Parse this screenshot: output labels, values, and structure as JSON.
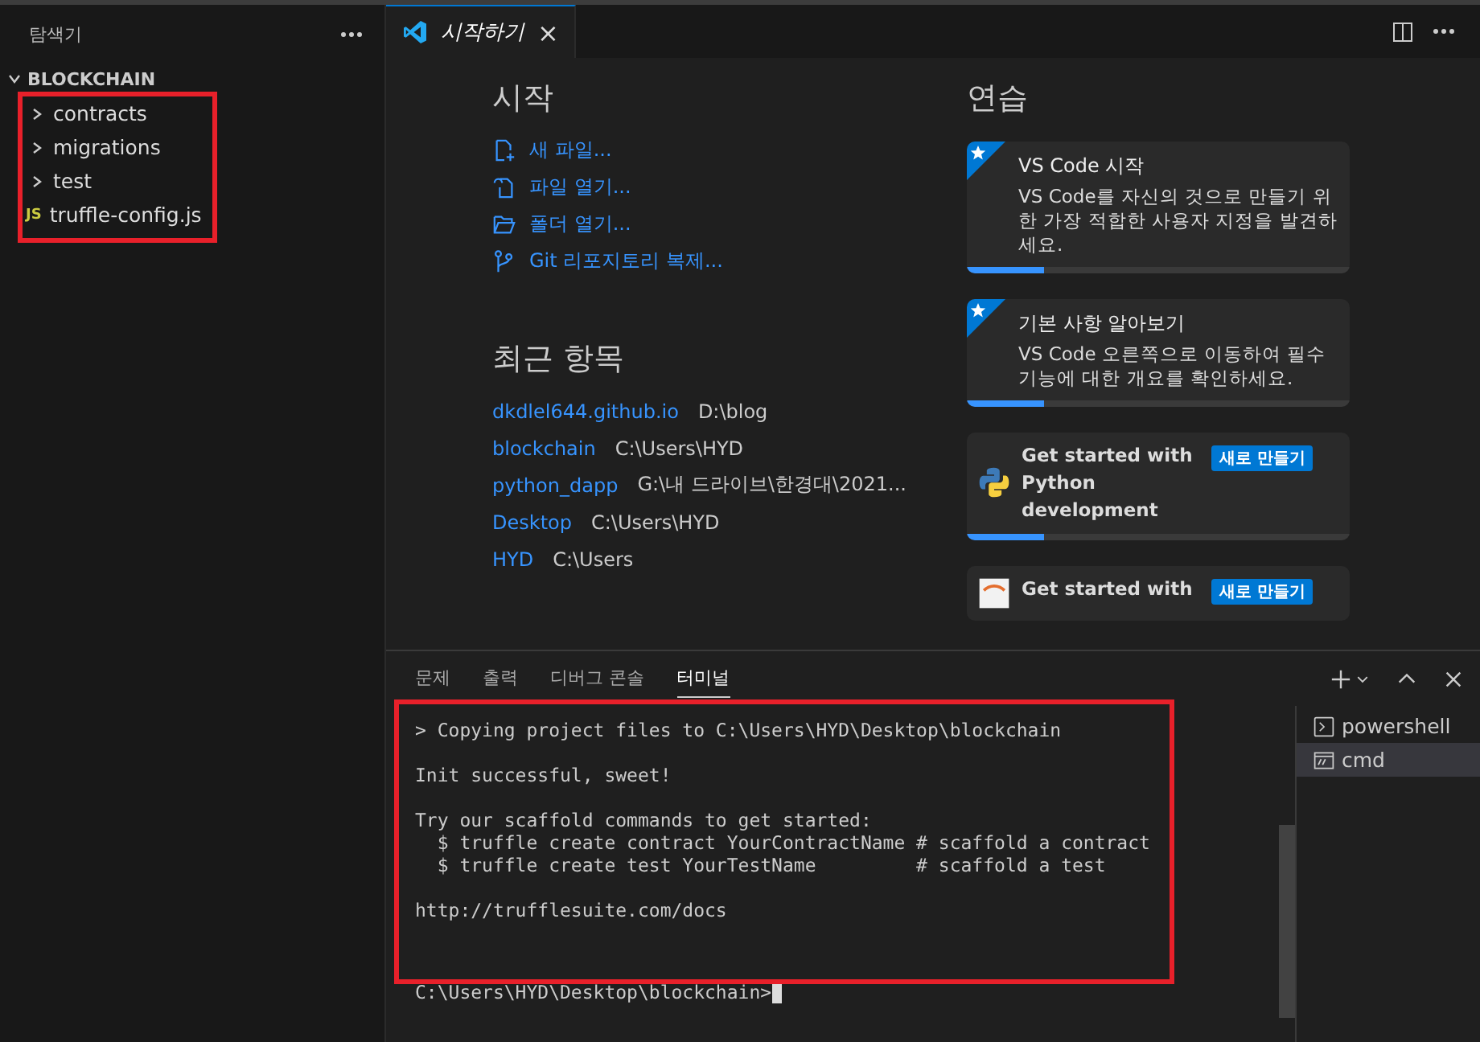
{
  "sidebar": {
    "title": "탐색기",
    "folder": {
      "name": "BLOCKCHAIN",
      "expanded": true
    },
    "items": [
      {
        "kind": "folder",
        "name": "contracts",
        "expanded": false
      },
      {
        "kind": "folder",
        "name": "migrations",
        "expanded": false
      },
      {
        "kind": "folder",
        "name": "test",
        "expanded": false
      },
      {
        "kind": "js",
        "name": "truffle-config.js",
        "badge": "JS"
      }
    ]
  },
  "editor_tabs": [
    {
      "label": "시작하기",
      "selected": true,
      "close": "×"
    }
  ],
  "welcome": {
    "start": {
      "heading": "시작",
      "actions": [
        {
          "kind": "new-file",
          "label": "새 파일..."
        },
        {
          "kind": "open-file",
          "label": "파일 열기..."
        },
        {
          "kind": "folder",
          "label": "폴더 열기..."
        },
        {
          "kind": "git",
          "label": "Git 리포지토리 복제..."
        }
      ]
    },
    "recent": {
      "heading": "최근 항목",
      "items": [
        {
          "name": "dkdlel644.github.io",
          "path": "D:\\blog"
        },
        {
          "name": "blockchain",
          "path": "C:\\Users\\HYD"
        },
        {
          "name": "python_dapp",
          "path": "G:\\내 드라이브\\한경대\\2021..."
        },
        {
          "name": "Desktop",
          "path": "C:\\Users\\HYD"
        },
        {
          "name": "HYD",
          "path": "C:\\Users"
        }
      ]
    },
    "walkthroughs": {
      "heading": "연습",
      "cards": [
        {
          "kind": "featured",
          "title": "VS Code 시작",
          "description": "VS Code를 자신의 것으로 만들기 위한 가장 적합한 사용자 지정을 발견하세요.",
          "level": 0.2
        },
        {
          "kind": "featured",
          "title": "기본 사항 알아보기",
          "description": "VS Code 오른쪽으로 이동하여 필수 기능에 대한 개요를 확인하세요.",
          "level": 0.2
        },
        {
          "kind": "python",
          "title": "Get started with Python development",
          "badge": "새로 만들기",
          "level": 0.2
        },
        {
          "kind": "jupyter",
          "title": "Get started with",
          "badge": "새로 만들기"
        }
      ]
    }
  },
  "panel": {
    "tabs": [
      {
        "label": "문제",
        "selected": false
      },
      {
        "label": "출력",
        "selected": false
      },
      {
        "label": "디버그 콘솔",
        "selected": false
      },
      {
        "label": "터미널",
        "selected": true
      }
    ],
    "terminal": {
      "blocks": [
        [
          "> Copying project files to C:\\Users\\HYD\\Desktop\\blockchain"
        ],
        [
          "Init successful, sweet!"
        ],
        [
          "Try our scaffold commands to get started:",
          "  $ truffle create contract YourContractName # scaffold a contract",
          "  $ truffle create test YourTestName         # scaffold a test"
        ],
        [
          "http://trufflesuite.com/docs"
        ]
      ],
      "prompt": "C:\\Users\\HYD\\Desktop\\blockchain>"
    },
    "terminals": [
      {
        "kind": "powershell",
        "name": "powershell",
        "selected": false
      },
      {
        "kind": "cmd",
        "name": "cmd",
        "selected": true
      }
    ]
  }
}
